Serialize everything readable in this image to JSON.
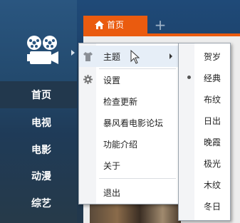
{
  "sidebar": {
    "items": [
      {
        "label": "首页",
        "active": true
      },
      {
        "label": "电视"
      },
      {
        "label": "电影"
      },
      {
        "label": "动漫"
      },
      {
        "label": "综艺"
      }
    ]
  },
  "tabs": {
    "items": [
      {
        "label": "首页",
        "icon": "home-icon"
      }
    ],
    "add_label": "+"
  },
  "menu": {
    "items": [
      {
        "label": "主题",
        "icon": "shirt-icon",
        "has_submenu": true
      },
      {
        "label": "设置",
        "icon": "gear-icon"
      },
      {
        "label": "检查更新"
      },
      {
        "label": "暴风看电影论坛"
      },
      {
        "label": "功能介绍"
      },
      {
        "label": "关于"
      },
      {
        "label": "退出"
      }
    ]
  },
  "theme_submenu": {
    "items": [
      {
        "label": "贺岁"
      },
      {
        "label": "经典",
        "selected": true
      },
      {
        "label": "布纹"
      },
      {
        "label": "日出"
      },
      {
        "label": "晚霞"
      },
      {
        "label": "极光"
      },
      {
        "label": "木纹"
      },
      {
        "label": "冬日"
      }
    ]
  },
  "colors": {
    "accent": "#ea5b0f",
    "sidebar_bg": "#234a6e",
    "menu_bg": "#ffffff"
  }
}
